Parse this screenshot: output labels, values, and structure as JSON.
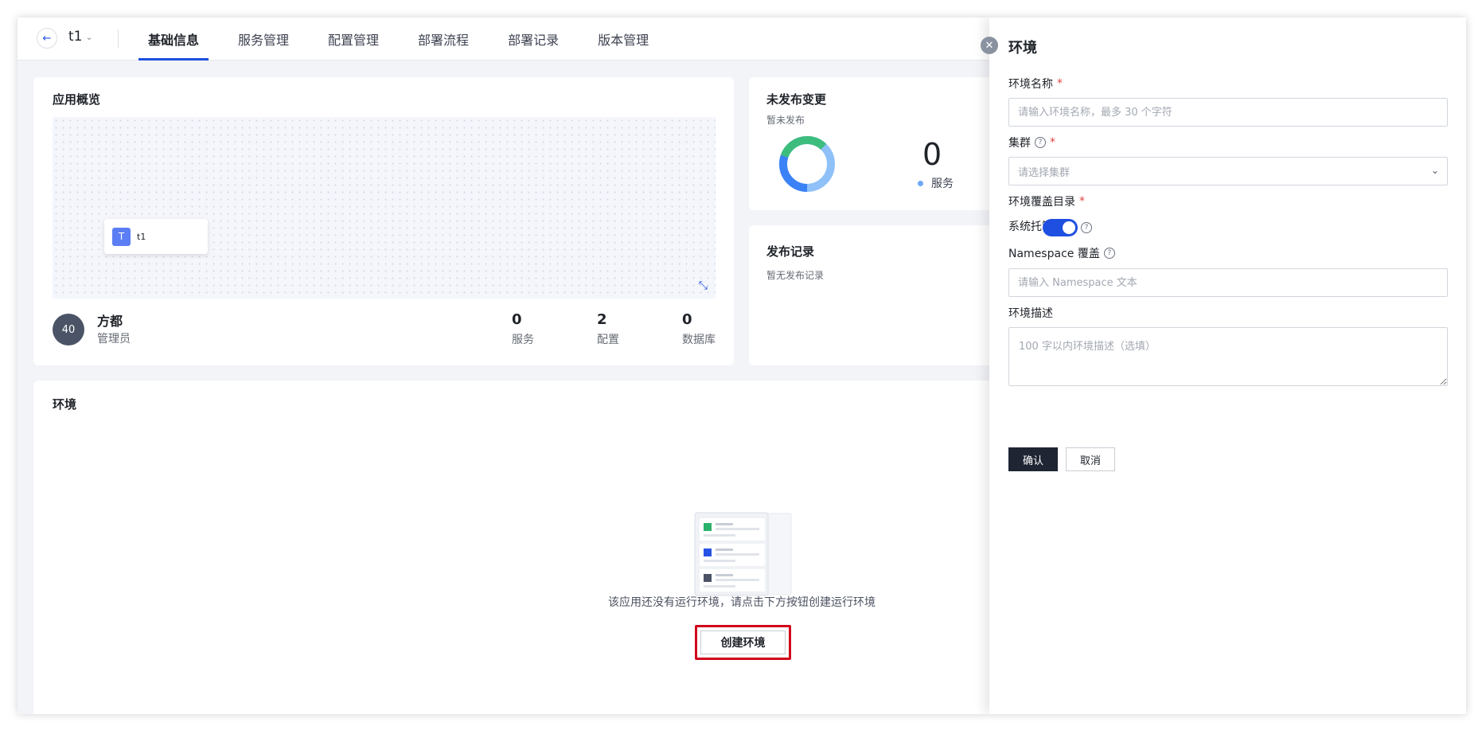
{
  "header": {
    "app_name": "t1",
    "tabs": [
      {
        "label": "基础信息",
        "active": true
      },
      {
        "label": "服务管理"
      },
      {
        "label": "配置管理"
      },
      {
        "label": "部署流程"
      },
      {
        "label": "部署记录"
      },
      {
        "label": "版本管理"
      }
    ]
  },
  "overview": {
    "title": "应用概览",
    "node": {
      "icon_letter": "T",
      "label": "t1"
    },
    "owner": {
      "avatar_text": "40",
      "name": "方都",
      "role": "管理员"
    },
    "stats": [
      {
        "value": "0",
        "label": "服务"
      },
      {
        "value": "2",
        "label": "配置"
      },
      {
        "value": "0",
        "label": "数据库"
      }
    ]
  },
  "unpublished": {
    "title": "未发布变更",
    "subtitle": "暂未发布",
    "count": "0",
    "legend_label": "服务",
    "colors": {
      "green": "#3dbd7d",
      "blue": "#3b82f6",
      "light_blue": "#8fc1f8"
    }
  },
  "records": {
    "title": "发布记录",
    "empty": "暂无发布记录"
  },
  "environment": {
    "title": "环境",
    "empty_text": "该应用还没有运行环境，请点击下方按钮创建运行环境",
    "create_button": "创建环境"
  },
  "drawer": {
    "title": "环境",
    "name_label": "环境名称",
    "name_placeholder": "请输入环境名称，最多 30 个字符",
    "cluster_label": "集群",
    "cluster_placeholder": "请选择集群",
    "override_label": "环境覆盖目录",
    "system_managed_label": "系统托管",
    "system_managed_on": true,
    "namespace_label": "Namespace 覆盖",
    "namespace_placeholder": "请输入 Namespace 文本",
    "desc_label": "环境描述",
    "desc_placeholder": "100 字以内环境描述（选填）",
    "confirm": "确认",
    "cancel": "取消"
  },
  "theme": {
    "accent": "#1e4fe0",
    "danger": "#d0021b"
  }
}
